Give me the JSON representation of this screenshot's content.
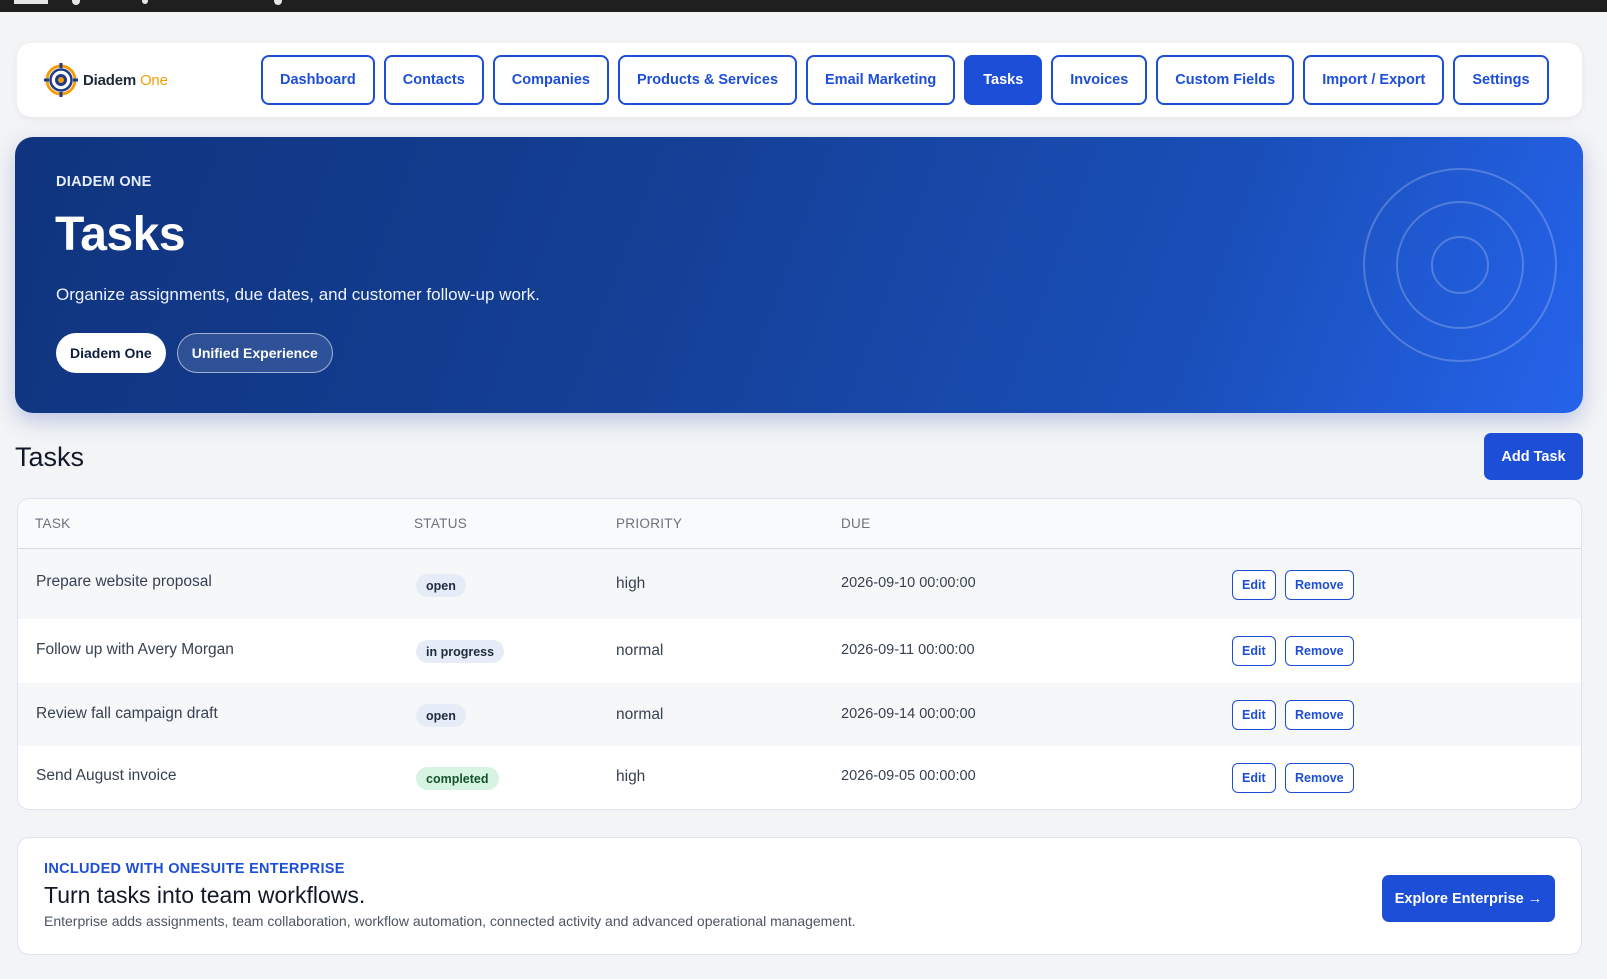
{
  "brand": {
    "name": "Diadem",
    "name_accent": "One"
  },
  "nav": {
    "items": [
      {
        "label": "Dashboard",
        "active": false
      },
      {
        "label": "Contacts",
        "active": false
      },
      {
        "label": "Companies",
        "active": false
      },
      {
        "label": "Products & Services",
        "active": false
      },
      {
        "label": "Email Marketing",
        "active": false
      },
      {
        "label": "Tasks",
        "active": true
      },
      {
        "label": "Invoices",
        "active": false
      },
      {
        "label": "Custom Fields",
        "active": false
      },
      {
        "label": "Import / Export",
        "active": false
      },
      {
        "label": "Settings",
        "active": false
      }
    ]
  },
  "hero": {
    "eyebrow": "DIADEM ONE",
    "title": "Tasks",
    "subtitle": "Organize assignments, due dates, and customer follow-up work.",
    "pill_primary": "Diadem One",
    "pill_secondary": "Unified Experience"
  },
  "section": {
    "title": "Tasks",
    "add_label": "Add Task"
  },
  "table": {
    "headers": {
      "task": "TASK",
      "status": "STATUS",
      "priority": "PRIORITY",
      "due": "DUE"
    },
    "edit_label": "Edit",
    "remove_label": "Remove",
    "rows": [
      {
        "task": "Prepare website proposal",
        "status": "open",
        "priority": "high",
        "due": "2026-09-10 00:00:00"
      },
      {
        "task": "Follow up with Avery Morgan",
        "status": "in progress",
        "priority": "normal",
        "due": "2026-09-11 00:00:00"
      },
      {
        "task": "Review fall campaign draft",
        "status": "open",
        "priority": "normal",
        "due": "2026-09-14 00:00:00"
      },
      {
        "task": "Send August invoice",
        "status": "completed",
        "priority": "high",
        "due": "2026-09-05 00:00:00"
      }
    ]
  },
  "enterprise": {
    "eyebrow": "INCLUDED WITH ONESUITE ENTERPRISE",
    "headline": "Turn tasks into team workflows.",
    "description": "Enterprise adds assignments, team collaboration, workflow automation, connected activity and advanced operational management.",
    "cta": "Explore Enterprise →"
  },
  "colors": {
    "primary": "#1d4ed8",
    "hero_dark": "#10347e",
    "hero_light": "#2563eb",
    "brand_accent": "#f59e0b",
    "status_completed_bg": "#d7f3e1"
  }
}
